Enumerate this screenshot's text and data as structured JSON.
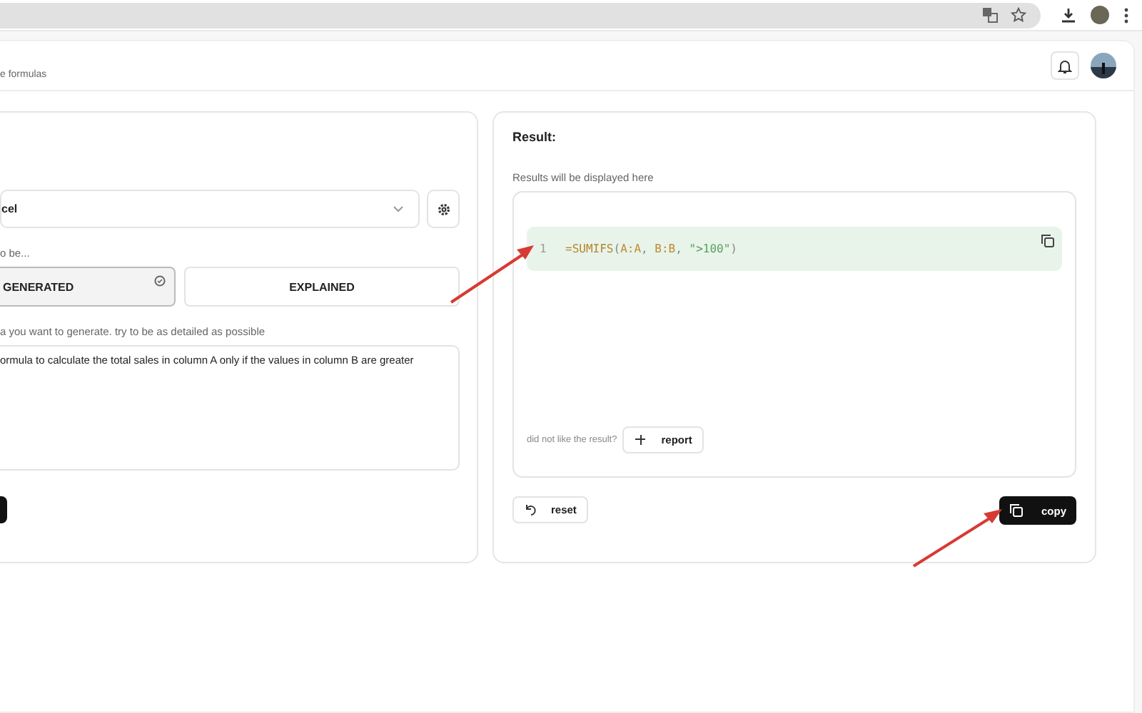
{
  "header": {
    "subtitle": "e formulas"
  },
  "left_panel": {
    "platform_select": {
      "value": "cel"
    },
    "mode_label": "o be...",
    "modes": [
      {
        "label": "GENERATED",
        "selected": true
      },
      {
        "label": "EXPLAINED",
        "selected": false
      }
    ],
    "prompt_label": "a you want to generate. try to be as detailed as possible",
    "prompt_value": "ormula to calculate the total sales in column A only if the values in column B are greater"
  },
  "result_panel": {
    "title": "Result:",
    "hint": "Results will be displayed here",
    "code_line_number": "1",
    "code_tokens": [
      {
        "kind": "op",
        "text": "="
      },
      {
        "kind": "func",
        "text": "SUMIFS"
      },
      {
        "kind": "punct",
        "text": "("
      },
      {
        "kind": "ref",
        "text": "A:A"
      },
      {
        "kind": "punct",
        "text": ", "
      },
      {
        "kind": "ref",
        "text": "B:B"
      },
      {
        "kind": "punct",
        "text": ", "
      },
      {
        "kind": "string",
        "text": "\">100\""
      },
      {
        "kind": "punct",
        "text": ")"
      }
    ],
    "feedback_prompt": "did not like the result?",
    "report_button": "report",
    "reset_button": "reset",
    "copy_button": "copy"
  }
}
